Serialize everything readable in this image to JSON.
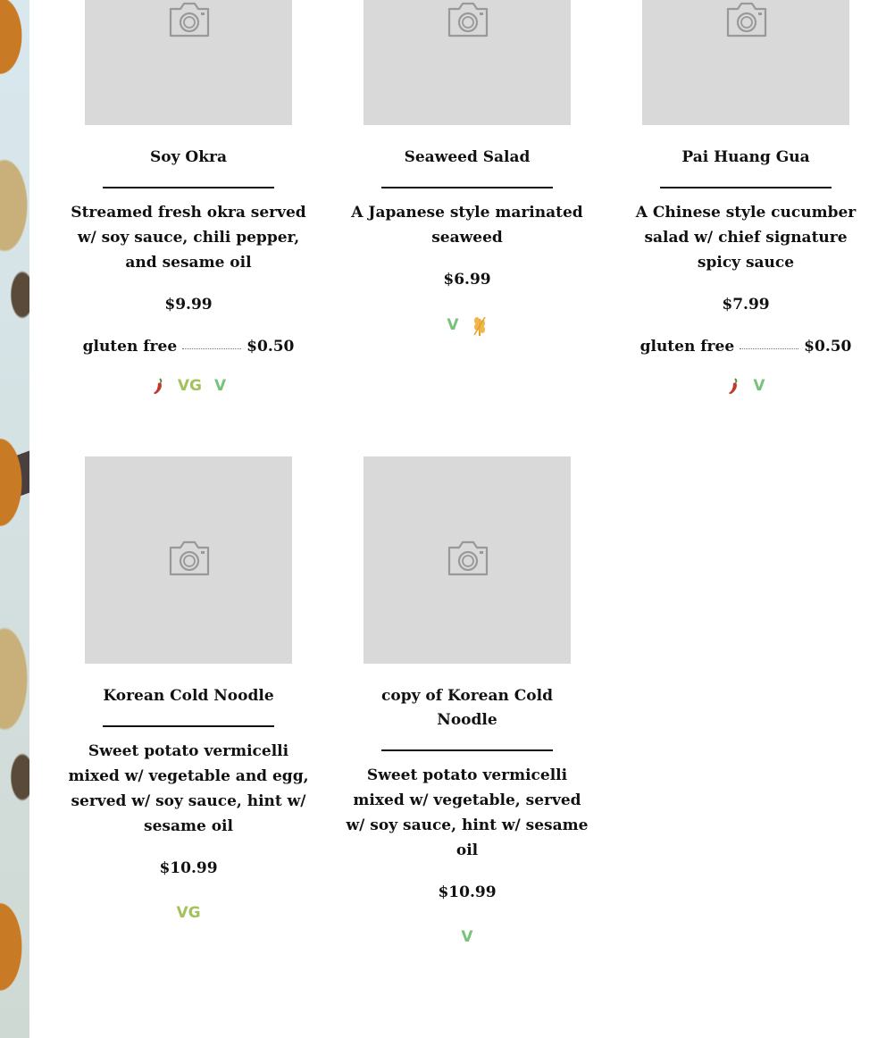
{
  "colors": {
    "photo_placeholder": "#d9d9d9",
    "vegetarian_green": "#78c27a",
    "vegan_green": "#a3c25b",
    "spicy_red": "#c0392b",
    "gluten_orange": "#e8a028"
  },
  "items": [
    {
      "name": "Soy Okra",
      "description": "Streamed fresh okra served w/ soy sauce, chili pepper, and sesame oil",
      "price": "$9.99",
      "option_label": "gluten free",
      "option_price": "$0.50",
      "tags": [
        "spicy-icon",
        "VG",
        "V"
      ]
    },
    {
      "name": "Seaweed Salad",
      "description": "A Japanese style marinated seaweed",
      "price": "$6.99",
      "tags": [
        "V",
        "gluten-free-icon"
      ]
    },
    {
      "name": "Pai Huang Gua",
      "description": "A Chinese style cucumber salad w/ chief signature spicy sauce",
      "price": "$7.99",
      "option_label": "gluten free",
      "option_price": "$0.50",
      "tags": [
        "spicy-icon",
        "V"
      ]
    },
    {
      "name": "Korean Cold Noodle",
      "description": "Sweet potato vermicelli mixed w/ vegetable and egg, served w/ soy sauce, hint w/ sesame oil",
      "price": "$10.99",
      "tags": [
        "VG"
      ]
    },
    {
      "name": "copy of Korean Cold Noodle",
      "description": "Sweet potato vermicelli mixed w/ vegetable, served w/ soy sauce, hint w/ sesame oil",
      "price": "$10.99",
      "tags": [
        "V"
      ]
    }
  ]
}
